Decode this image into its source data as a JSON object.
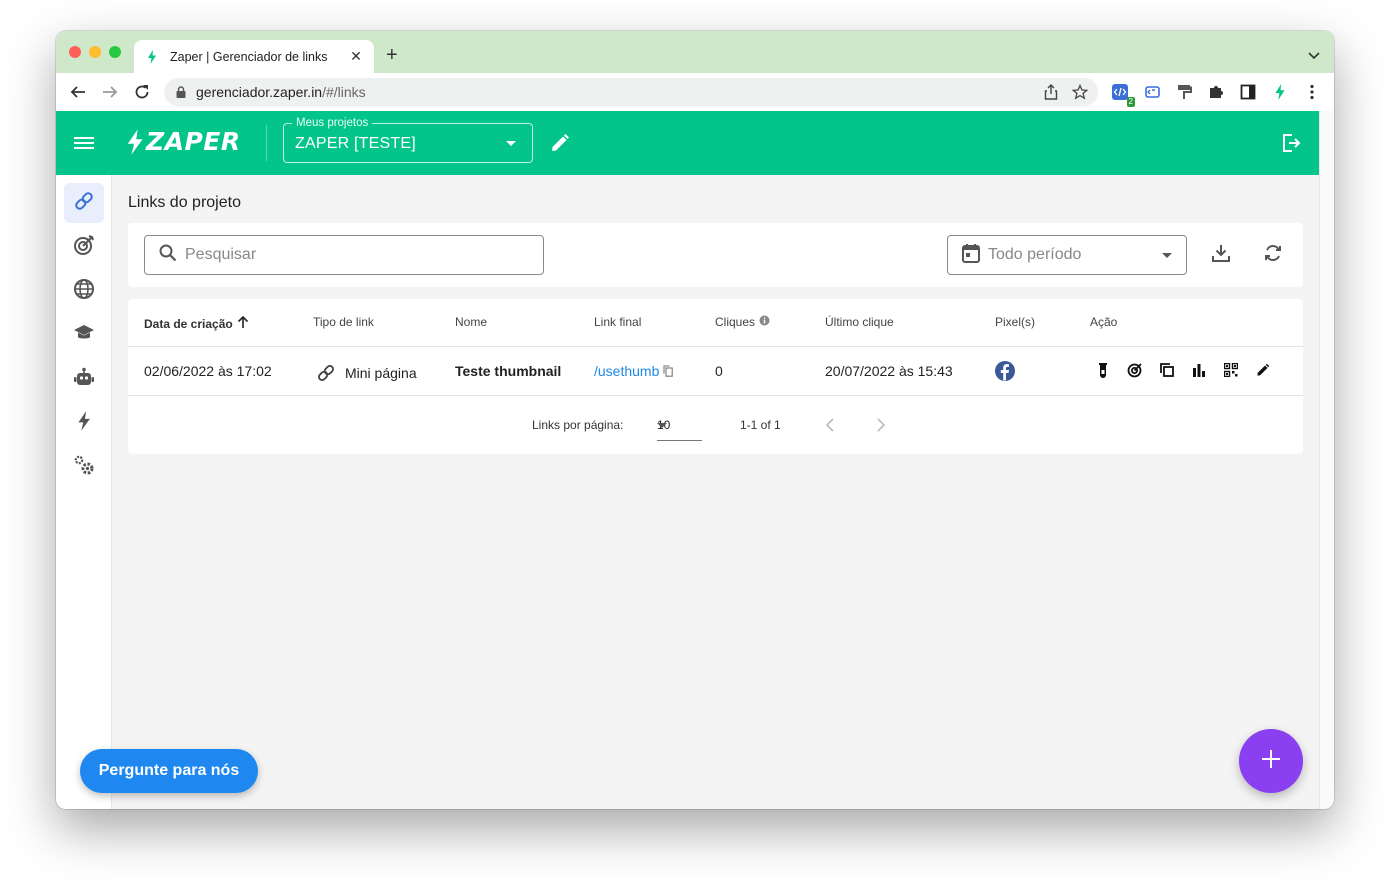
{
  "browser": {
    "tab_title": "Zaper | Gerenciador de links",
    "url_host": "gerenciador.zaper.in",
    "url_path": "/#/links",
    "extension_badge": "2"
  },
  "header": {
    "logo_text": "ZAPER",
    "project_label": "Meus projetos",
    "project_value": "ZAPER [TESTE]"
  },
  "sidebar": {
    "items": [
      {
        "icon": "link-icon",
        "active": true
      },
      {
        "icon": "target-icon"
      },
      {
        "icon": "globe-icon"
      },
      {
        "icon": "school-icon"
      },
      {
        "icon": "robot-icon"
      },
      {
        "icon": "bolt-icon"
      },
      {
        "icon": "settings-icon"
      }
    ]
  },
  "main": {
    "title": "Links do projeto",
    "search_placeholder": "Pesquisar",
    "period_value": "Todo período"
  },
  "table": {
    "headers": {
      "created": "Data de criação",
      "type": "Tipo de link",
      "name": "Nome",
      "final_link": "Link final",
      "clicks": "Cliques",
      "last_click": "Último clique",
      "pixels": "Pixel(s)",
      "action": "Ação"
    },
    "rows": [
      {
        "created": "02/06/2022 às 17:02",
        "type": "Mini página",
        "name": "Teste thumbnail",
        "final_link": "/usethumb",
        "clicks": "0",
        "last_click": "20/07/2022 às 15:43",
        "pixel": "facebook"
      }
    ],
    "pagination": {
      "per_page_label": "Links por página:",
      "per_page_value": "10",
      "range": "1-1 of 1"
    }
  },
  "floating": {
    "ask_label": "Pergunte para nós"
  },
  "colors": {
    "brand_green": "#03c489",
    "fab_purple": "#8a3ff0",
    "ask_blue": "#1e88f0",
    "link_blue": "#1e88e5",
    "facebook_blue": "#3b5998"
  }
}
